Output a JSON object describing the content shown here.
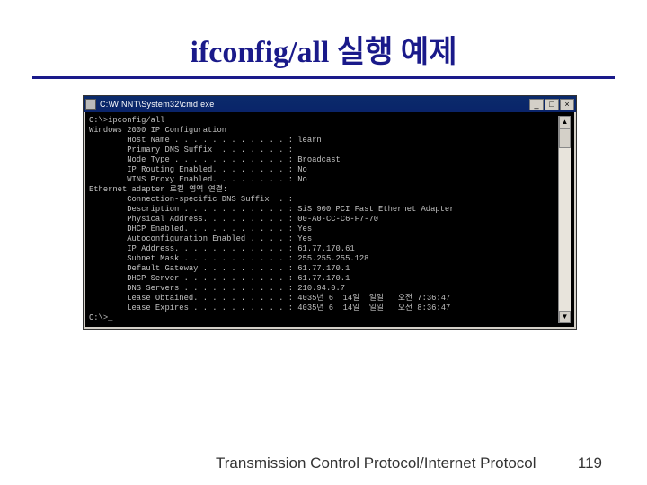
{
  "title": "ifconfig/all 실행 예제",
  "footer": {
    "text": "Transmission Control Protocol/Internet Protocol",
    "page": "119"
  },
  "win": {
    "title": "C:\\WINNT\\System32\\cmd.exe",
    "min": "_",
    "max": "□",
    "close": "×",
    "scroll_up": "▲",
    "scroll_down": "▼"
  },
  "term": {
    "l0": "C:\\>ipconfig/all",
    "l1": "",
    "l2": "Windows 2000 IP Configuration",
    "l3": "",
    "l4": "        Host Name . . . . . . . . . . . . : learn",
    "l5": "        Primary DNS Suffix  . . . . . . . :",
    "l6": "        Node Type . . . . . . . . . . . . : Broadcast",
    "l7": "        IP Routing Enabled. . . . . . . . : No",
    "l8": "        WINS Proxy Enabled. . . . . . . . : No",
    "l9": "",
    "l10": "Ethernet adapter 로컬 영역 연결:",
    "l11": "",
    "l12": "        Connection-specific DNS Suffix  . :",
    "l13": "        Description . . . . . . . . . . . : SiS 900 PCI Fast Ethernet Adapter",
    "l14": "        Physical Address. . . . . . . . . : 00-A0-CC-C6-F7-70",
    "l15": "        DHCP Enabled. . . . . . . . . . . : Yes",
    "l16": "        Autoconfiguration Enabled . . . . : Yes",
    "l17": "        IP Address. . . . . . . . . . . . : 61.77.170.61",
    "l18": "        Subnet Mask . . . . . . . . . . . : 255.255.255.128",
    "l19": "        Default Gateway . . . . . . . . . : 61.77.170.1",
    "l20": "        DHCP Server . . . . . . . . . . . : 61.77.170.1",
    "l21": "        DNS Servers . . . . . . . . . . . : 210.94.0.7",
    "l22": "        Lease Obtained. . . . . . . . . . : 4035년 6  14일  일일   오전 7:36:47",
    "l23": "        Lease Expires . . . . . . . . . . : 4035년 6  14일  일일   오전 8:36:47",
    "l24": "",
    "l25": "C:\\>_"
  }
}
